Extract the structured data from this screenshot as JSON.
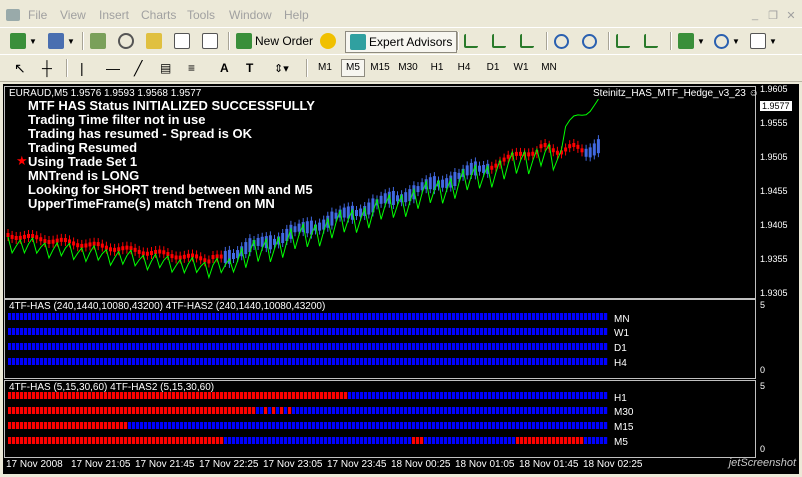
{
  "menu": [
    "File",
    "View",
    "Insert",
    "Charts",
    "Tools",
    "Window",
    "Help"
  ],
  "toolbar": {
    "new_order": "New Order",
    "expert_advisors": "Expert Advisors"
  },
  "timeframes": [
    "M1",
    "M5",
    "M15",
    "M30",
    "H1",
    "H4",
    "D1",
    "W1",
    "MN"
  ],
  "active_timeframe": "M5",
  "chart": {
    "symbol_info": "EURAUD,M5  1.9576 1.9593 1.9568 1.9577",
    "ea_name": "Steinitz_HAS_MTF_Hedge_v3_23 ☺",
    "current_price": "1.9577",
    "messages": [
      "MTF HAS Status INITIALIZED SUCCESSFULLY",
      "Trading Time filter not in use",
      "Trading has resumed - Spread is OK",
      "Trading Resumed",
      "Using Trade Set 1",
      "MNTrend is LONG",
      "Looking for SHORT trend between MN and M5",
      "UpperTimeFrame(s) match Trend on MN"
    ],
    "star_marker": "★",
    "price_ticks": [
      "1.9605",
      "1.9555",
      "1.9505",
      "1.9455",
      "1.9405",
      "1.9355",
      "1.9305"
    ]
  },
  "indicator1": {
    "label": "4TF-HAS (240,1440,10080,43200)  4TF-HAS2 (240,1440,10080,43200)",
    "rows": [
      "MN",
      "W1",
      "D1",
      "H4"
    ],
    "scale_top": "5",
    "scale_bottom": "0"
  },
  "indicator2": {
    "label": "4TF-HAS (5,15,30,60)  4TF-HAS2 (5,15,30,60)",
    "rows": [
      "H1",
      "M30",
      "M15",
      "M5"
    ],
    "scale_top": "5",
    "scale_bottom": "0"
  },
  "time_axis": [
    "17 Nov 2008",
    "17 Nov 21:05",
    "17 Nov 21:45",
    "17 Nov 22:25",
    "17 Nov 23:05",
    "17 Nov 23:45",
    "18 Nov 00:25",
    "18 Nov 01:05",
    "18 Nov 01:45",
    "18 Nov 02:25"
  ],
  "watermark": "jetScreenshot",
  "colors": {
    "bull": "#4169e1",
    "bear": "#ff0000",
    "line": "#00ff00",
    "bg": "#000000",
    "rows_blue": "#0000ff"
  }
}
